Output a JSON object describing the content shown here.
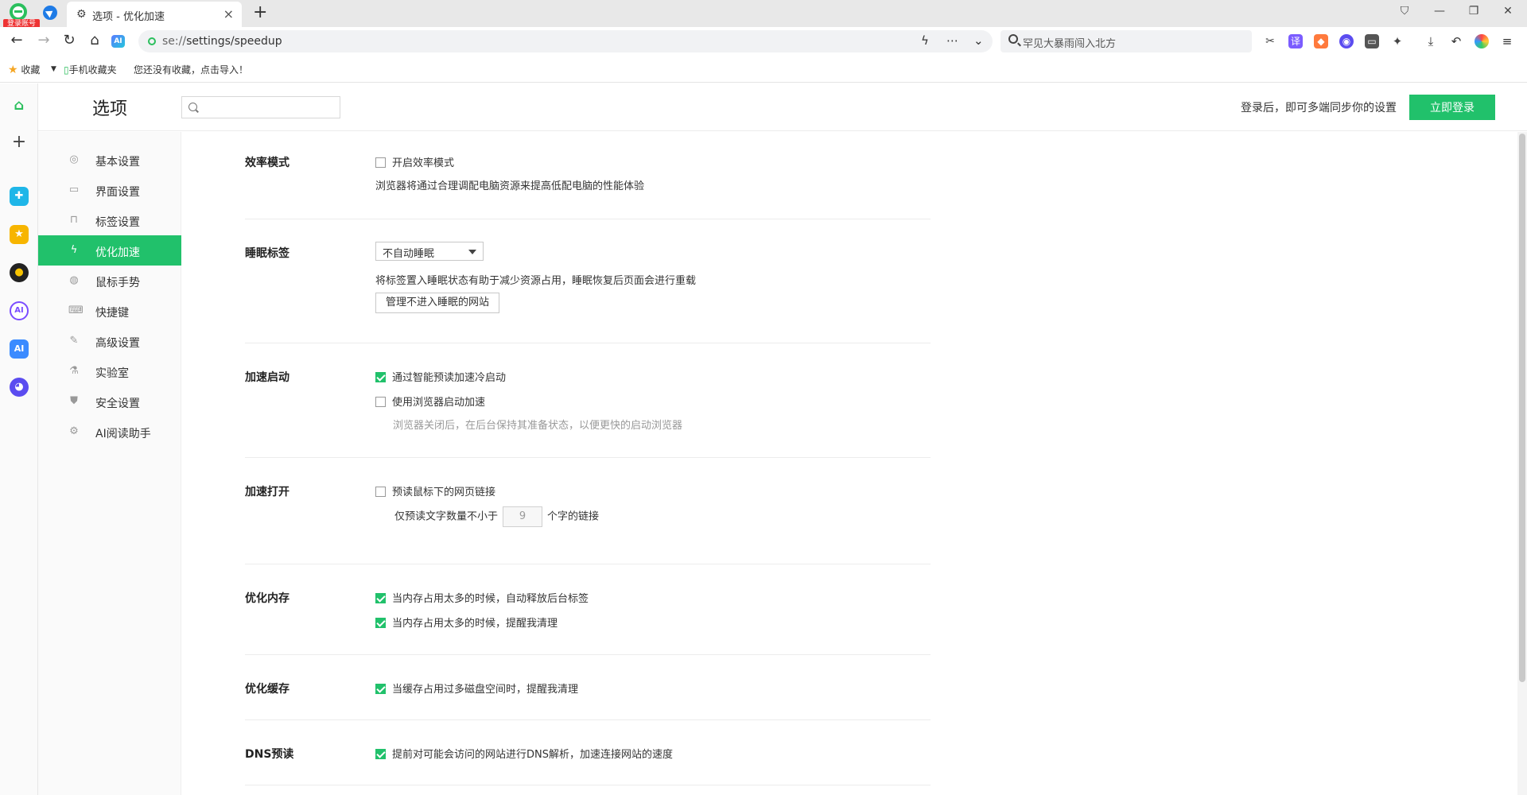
{
  "profile": {
    "badge": "登录账号"
  },
  "tab": {
    "title": "选项 - 优化加速"
  },
  "window": {
    "restore_icon": "restore-icon",
    "minimize": "—",
    "maximize": "❐",
    "close": "✕"
  },
  "address": {
    "url_scheme": "se://",
    "url_path": "settings/speedup"
  },
  "search": {
    "placeholder": "罕见大暴雨闯入北方"
  },
  "bookmarks": {
    "favorites": "收藏",
    "mobile": "手机收藏夹",
    "hint": "您还没有收藏，点击导入！"
  },
  "header": {
    "title": "选项",
    "login_hint": "登录后，即可多端同步你的设置",
    "login_button": "立即登录"
  },
  "nav": {
    "items": [
      {
        "label": "基本设置",
        "icon": "gear-icon"
      },
      {
        "label": "界面设置",
        "icon": "window-icon"
      },
      {
        "label": "标签设置",
        "icon": "tab-icon"
      },
      {
        "label": "优化加速",
        "icon": "lightning-icon"
      },
      {
        "label": "鼠标手势",
        "icon": "mouse-icon"
      },
      {
        "label": "快捷键",
        "icon": "keyboard-icon"
      },
      {
        "label": "高级设置",
        "icon": "wrench-icon"
      },
      {
        "label": "实验室",
        "icon": "flask-icon"
      },
      {
        "label": "安全设置",
        "icon": "shield-icon"
      },
      {
        "label": "AI阅读助手",
        "icon": "ai-icon"
      }
    ],
    "active_index": 3
  },
  "sections": {
    "efficiency": {
      "title": "效率模式",
      "option": {
        "label": "开启效率模式",
        "checked": false
      },
      "desc": "浏览器将通过合理调配电脑资源来提高低配电脑的性能体验"
    },
    "sleep": {
      "title": "睡眠标签",
      "select_value": "不自动睡眠",
      "desc": "将标签置入睡眠状态有助于减少资源占用，睡眠恢复后页面会进行重载",
      "button": "管理不进入睡眠的网站"
    },
    "startup": {
      "title": "加速启动",
      "opt1": {
        "label": "通过智能预读加速冷启动",
        "checked": true
      },
      "opt2": {
        "label": "使用浏览器启动加速",
        "checked": false
      },
      "subdesc": "浏览器关闭后，在后台保持其准备状态，以便更快的启动浏览器"
    },
    "open": {
      "title": "加速打开",
      "opt1": {
        "label": "预读鼠标下的网页链接",
        "checked": false
      },
      "min_prefix": "仅预读文字数量不小于",
      "min_value": "9",
      "min_suffix": "个字的链接"
    },
    "memory": {
      "title": "优化内存",
      "opt1": {
        "label": "当内存占用太多的时候，自动释放后台标签",
        "checked": true
      },
      "opt2": {
        "label": "当内存占用太多的时候，提醒我清理",
        "checked": true
      }
    },
    "cache": {
      "title": "优化缓存",
      "opt1": {
        "label": "当缓存占用过多磁盘空间时，提醒我清理",
        "checked": true
      }
    },
    "dns": {
      "title": "DNS预读",
      "opt1": {
        "label": "提前对可能会访问的网站进行DNS解析，加速连接网站的速度",
        "checked": true
      }
    }
  },
  "colors": {
    "accent": "#21c16b",
    "brand_green": "#2bbf5d"
  }
}
